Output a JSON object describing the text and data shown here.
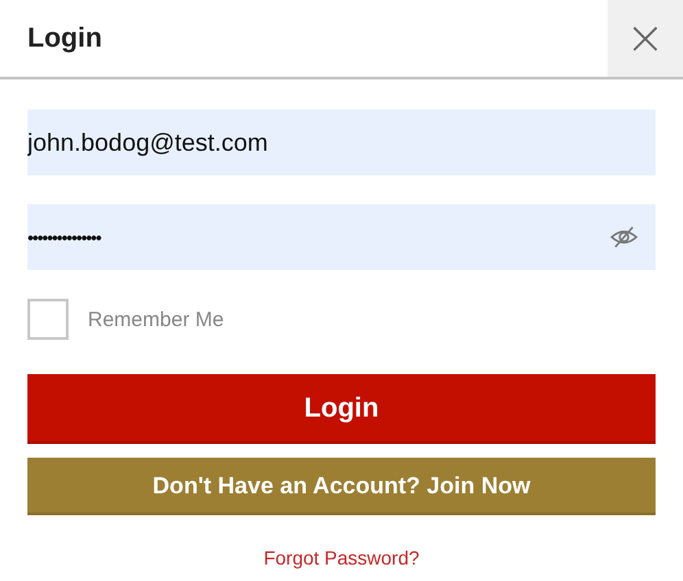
{
  "dialog": {
    "title": "Login",
    "close": "×"
  },
  "email": {
    "value": "john.bodog@test.com"
  },
  "password": {
    "value": "•••••••••••••••",
    "visible": false
  },
  "remember": {
    "label": "Remember Me",
    "checked": false
  },
  "buttons": [
    {
      "kind": "primary",
      "label": "Login"
    },
    {
      "kind": "secondary",
      "label": "Don't Have an Account? Join Now"
    }
  ],
  "forgot_link": "Forgot Password?"
}
